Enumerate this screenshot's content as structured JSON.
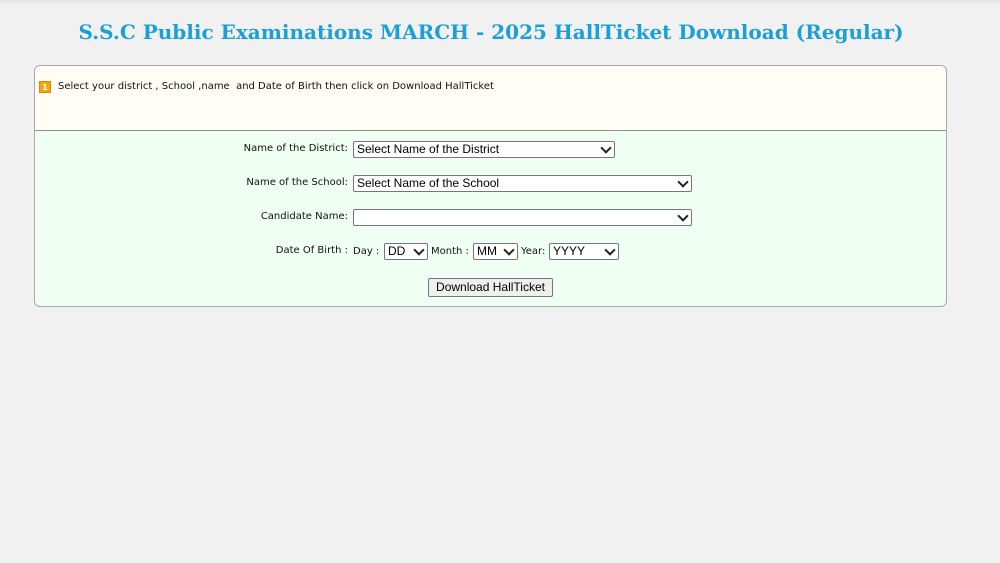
{
  "page": {
    "title": "S.S.C Public Examinations MARCH - 2025 HallTicket Download (Regular)",
    "title_color": "#1a9fd9"
  },
  "instruction": {
    "icon": "info-icon",
    "text": "Select your district , School ,name  and Date of Birth then click on Download HallTicket"
  },
  "form": {
    "district": {
      "label": "Name of the District:",
      "selected": "Select Name of the District"
    },
    "school": {
      "label": "Name of the School:",
      "selected": "Select Name of the School"
    },
    "candidate": {
      "label": "Candidate Name:",
      "selected": ""
    },
    "dob": {
      "label": "Date Of Birth :",
      "day_label": "Day :",
      "day_selected": "DD",
      "month_label": "Month :",
      "month_selected": "MM",
      "year_label": "Year:",
      "year_selected": "YYYY"
    },
    "submit_label": "Download HallTicket"
  }
}
